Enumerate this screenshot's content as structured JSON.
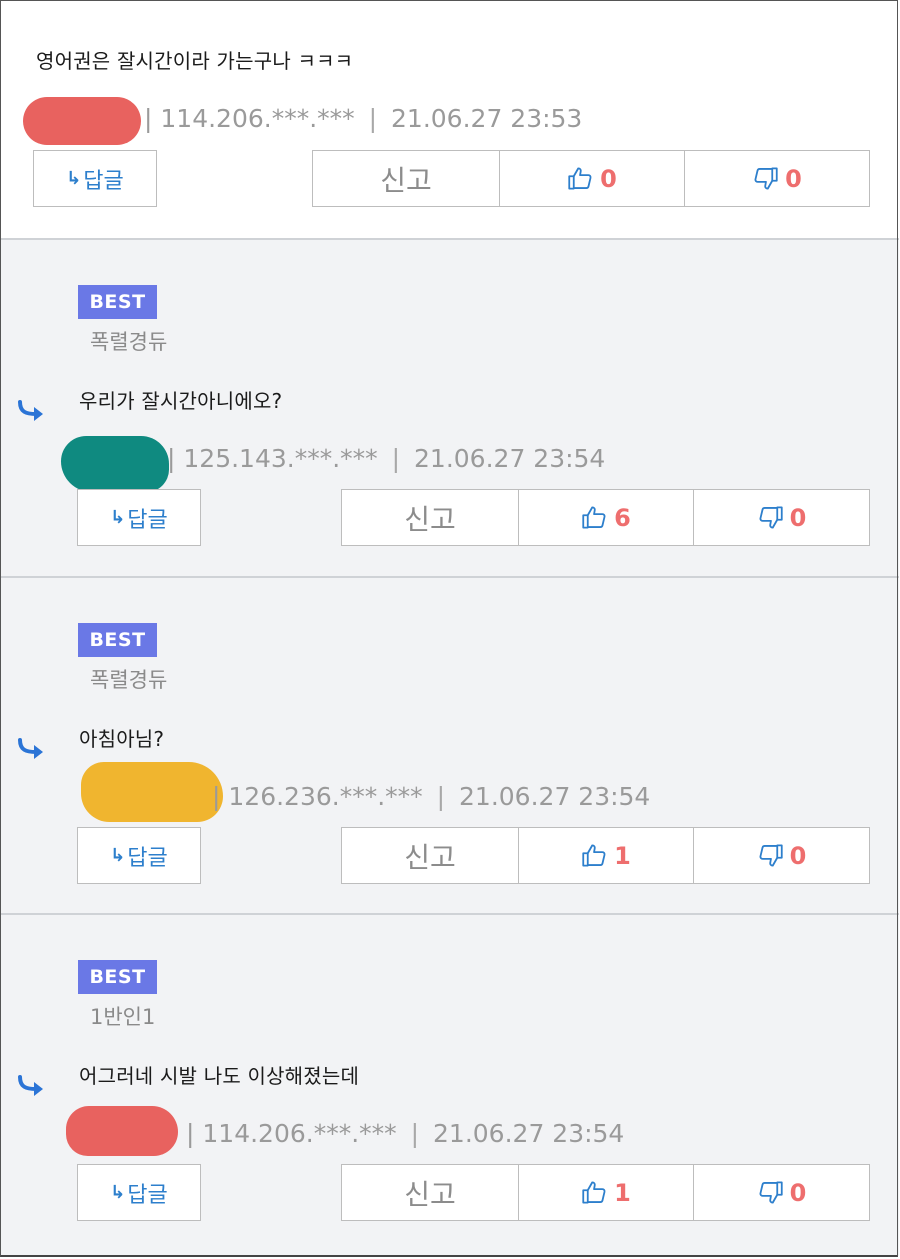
{
  "labels": {
    "reply": "답글",
    "reply_arrow": "↳",
    "report": "신고",
    "best_badge": "BEST",
    "separator": "|"
  },
  "colors": {
    "best_badge": "#6a78e6",
    "like_count": "#ee6e6e",
    "reply_text": "#2d7fcc",
    "redaction_red": "#e8625f",
    "redaction_teal": "#0f8a80",
    "redaction_yellow": "#f0b52f"
  },
  "comments": [
    {
      "best": false,
      "nickname": "",
      "content": "영어권은 잘시간이라 가는구나 ㅋㅋㅋ",
      "ip": "114.206.***.***",
      "time": "21.06.27 23:53",
      "likes": "0",
      "dislikes": "0",
      "redaction_color": "#e8625f"
    },
    {
      "best": true,
      "nickname": "폭렬경듀",
      "content": "우리가 잘시간아니에오?",
      "ip": "125.143.***.***",
      "time": "21.06.27 23:54",
      "likes": "6",
      "dislikes": "0",
      "redaction_color": "#0f8a80"
    },
    {
      "best": true,
      "nickname": "폭렬경듀",
      "content": "아침아님?",
      "ip": "126.236.***.***",
      "time": "21.06.27 23:54",
      "likes": "1",
      "dislikes": "0",
      "redaction_color": "#f0b52f"
    },
    {
      "best": true,
      "nickname": "1반인1",
      "content": "어그러네 시발 나도 이상해졌는데",
      "ip": "114.206.***.***",
      "time": "21.06.27 23:54",
      "likes": "1",
      "dislikes": "0",
      "redaction_color": "#e8625f"
    }
  ],
  "icons": {
    "like": "thumbs-up-icon",
    "dislike": "thumbs-down-icon",
    "reply_marker": "reply-arrow-icon"
  }
}
